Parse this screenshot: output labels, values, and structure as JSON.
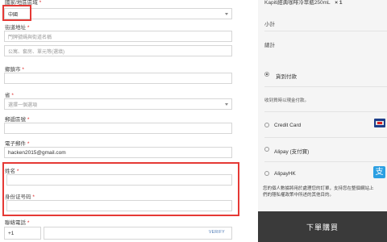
{
  "form": {
    "country_label": "國家/地區區域",
    "country_value": "中國",
    "street_label": "街道地址",
    "street_placeholder1": "門牌號碼與街道名稱",
    "street_placeholder2": "公寓、套房、單元等(選填)",
    "city_label": "鄉鎮市",
    "province_label": "省",
    "province_value": "選擇一個選項",
    "postal_label": "郵遞區號",
    "email_label": "電子郵件",
    "email_value": "hacken2015@gmail.com",
    "name_label": "姓名",
    "id_label": "身份证号码",
    "phone_label": "聯絡電話",
    "phone_code": "+1",
    "verify_label": "VERIFY",
    "required_mark": "*"
  },
  "order": {
    "product_line": "Kapiti經典咖啡冷萃瓶250mL",
    "product_qty": "× 1",
    "subtotal_label": "小計",
    "total_label": "總計"
  },
  "payment": {
    "cod_label": "貨到付款",
    "cod_desc": "收到貨時以現金付款。",
    "options": [
      {
        "label": "Credit Card",
        "icon": "credit-card-icon"
      },
      {
        "label": "Alipay (支付寶)",
        "icon": ""
      },
      {
        "label": "AlipayHK",
        "icon": "alipay-icon"
      }
    ],
    "privacy_text_1": "您的個人數據將用於處理您的訂單，支持您在整個網站上",
    "privacy_text_2": "們的隱私權政策中所述的其他目的。",
    "place_order_label": "下單購買"
  },
  "colors": {
    "accent_red": "#e53935",
    "button_bg": "#3a3a3a",
    "right_bg": "#f5f5f5",
    "verify_blue": "#4a77b4"
  }
}
